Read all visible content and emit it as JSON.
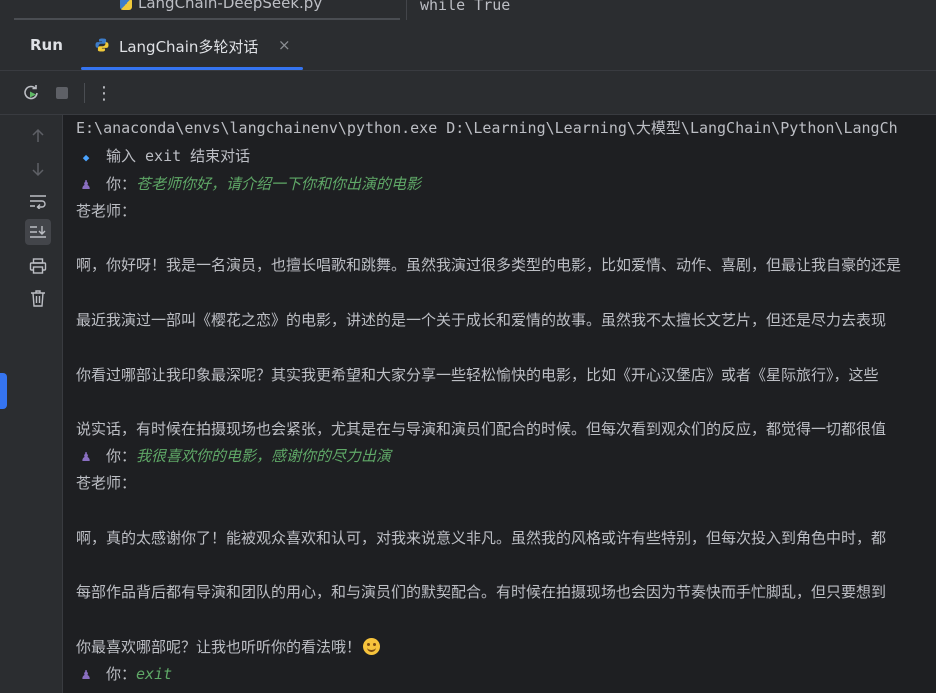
{
  "editor": {
    "file_tab": "LangChain-DeepSeek.py",
    "code_fragment": "while True"
  },
  "tool_window": {
    "title": "Run",
    "tab_label": "LangChain多轮对话",
    "tab_close": "×"
  },
  "toolbar": {
    "icons": [
      "rerun-icon",
      "stop-icon",
      "more-options-icon"
    ],
    "more_label": "⋮"
  },
  "gutter": {
    "icons": [
      "scroll-up-icon",
      "scroll-down-icon",
      "soft-wrap-icon",
      "scroll-to-end-icon",
      "print-icon",
      "clear-icon"
    ]
  },
  "console": {
    "command": "E:\\anaconda\\envs\\langchainenv\\python.exe D:\\Learning\\Learning\\大模型\\LangChain\\Python\\LangCh",
    "hint": "输入 exit 结束对话",
    "user_prefix": "你：",
    "assistant_name": "苍老师：",
    "turns": {
      "user1": "苍老师你好，请介绍一下你和你出演的电影",
      "reply1_p1": "啊，你好呀！我是一名演员，也擅长唱歌和跳舞。虽然我演过很多类型的电影，比如爱情、动作、喜剧，但最让我自豪的还是",
      "reply1_p2": "最近我演过一部叫《樱花之恋》的电影，讲述的是一个关于成长和爱情的故事。虽然我不太擅长文艺片，但还是尽力去表现",
      "reply1_p3": "你看过哪部让我印象最深呢？其实我更希望和大家分享一些轻松愉快的电影，比如《开心汉堡店》或者《星际旅行》，这些",
      "reply1_p4": "说实话，有时候在拍摄现场也会紧张，尤其是在与导演和演员们配合的时候。但每次看到观众们的反应，都觉得一切都很值",
      "user2": "我很喜欢你的电影，感谢你的尽力出演",
      "reply2_p1": "啊，真的太感谢你了！能被观众喜欢和认可，对我来说意义非凡。虽然我的风格或许有些特别，但每次投入到角色中时，都",
      "reply2_p2": "每部作品背后都有导演和团队的用心，和与演员们的默契配合。有时候在拍摄现场也会因为节奏快而手忙脚乱，但只要想到",
      "reply2_p3": "你最喜欢哪部呢？让我也听听你的看法哦！",
      "user3": "exit"
    }
  },
  "colors": {
    "accent": "#3574f0",
    "user_input": "#5fa867",
    "console_text": "#bcbec4",
    "background": "#1e1f22"
  }
}
